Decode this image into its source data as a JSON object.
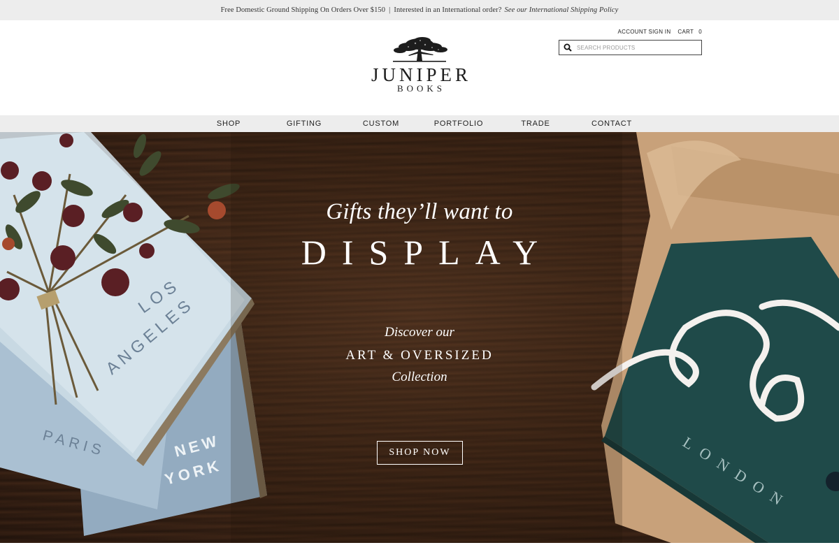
{
  "announcement": {
    "shipping_text": "Free Domestic Ground Shipping On Orders Over $150",
    "separator": "|",
    "international_text": "Interested in an International order?",
    "policy_link": "See our International Shipping Policy"
  },
  "brand": {
    "name_main": "JUNIPER",
    "name_sub": "BOOKS"
  },
  "header": {
    "account_link": "ACCOUNT SIGN IN",
    "cart_label": "CART",
    "cart_count": "0",
    "search_placeholder": "SEARCH PRODUCTS"
  },
  "nav": {
    "items": [
      {
        "label": "SHOP"
      },
      {
        "label": "GIFTING"
      },
      {
        "label": "CUSTOM"
      },
      {
        "label": "PORTFOLIO"
      },
      {
        "label": "TRADE"
      },
      {
        "label": "CONTACT"
      }
    ]
  },
  "hero": {
    "headline_italic": "Gifts they’ll want to",
    "headline_caps": "DISPLAY",
    "sub_line_1": "Discover our",
    "sub_line_2": "ART & OVERSIZED",
    "sub_line_3": "Collection",
    "cta_label": "SHOP NOW",
    "book_titles": {
      "los_angeles_1": "LOS",
      "los_angeles_2": "ANGELES",
      "paris": "PARIS",
      "new_york_1": "NEW",
      "new_york_2": "YORK",
      "london": "LONDON"
    }
  },
  "colors": {
    "announce_bg": "#ededed",
    "nav_bg": "#ededed",
    "wood_dark": "#2a1a10",
    "book_teal": "#1f4a49",
    "book_paleblue": "#a9bfcf",
    "kraft_paper": "#c8a17a"
  }
}
